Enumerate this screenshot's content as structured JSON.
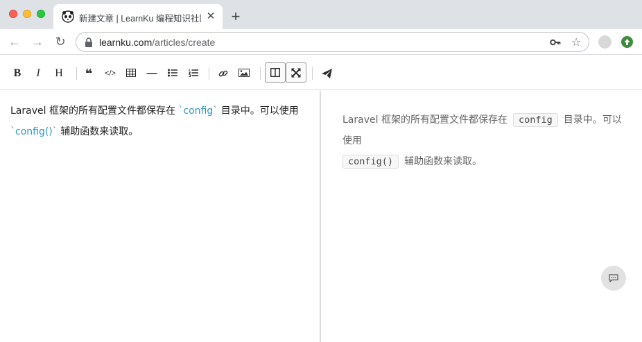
{
  "browser": {
    "tab": {
      "title": "新建文章 | LearnKu 编程知识社区"
    },
    "url": {
      "domain": "learnku.com",
      "path": "/articles/create"
    }
  },
  "toolbar": {
    "bold": "B",
    "italic": "I",
    "heading": "H",
    "quote": "❝",
    "code": "</>",
    "hr": "—"
  },
  "editor": {
    "line1_prefix": "Laravel 框架的所有配置文件都保存在 ",
    "line1_code": "`config`",
    "line1_suffix": " 目录中。可以使用",
    "line2_code": "`config()`",
    "line2_suffix": " 辅助函数来读取。"
  },
  "preview": {
    "text1": "Laravel 框架的所有配置文件都保存在",
    "code1": "config",
    "text2": "目录中。可以使用",
    "code2": "config()",
    "text3": "辅助函数来读取。"
  },
  "icons": {
    "favicon": "panda-logo-icon",
    "chat": "chat-bubble-icon"
  }
}
